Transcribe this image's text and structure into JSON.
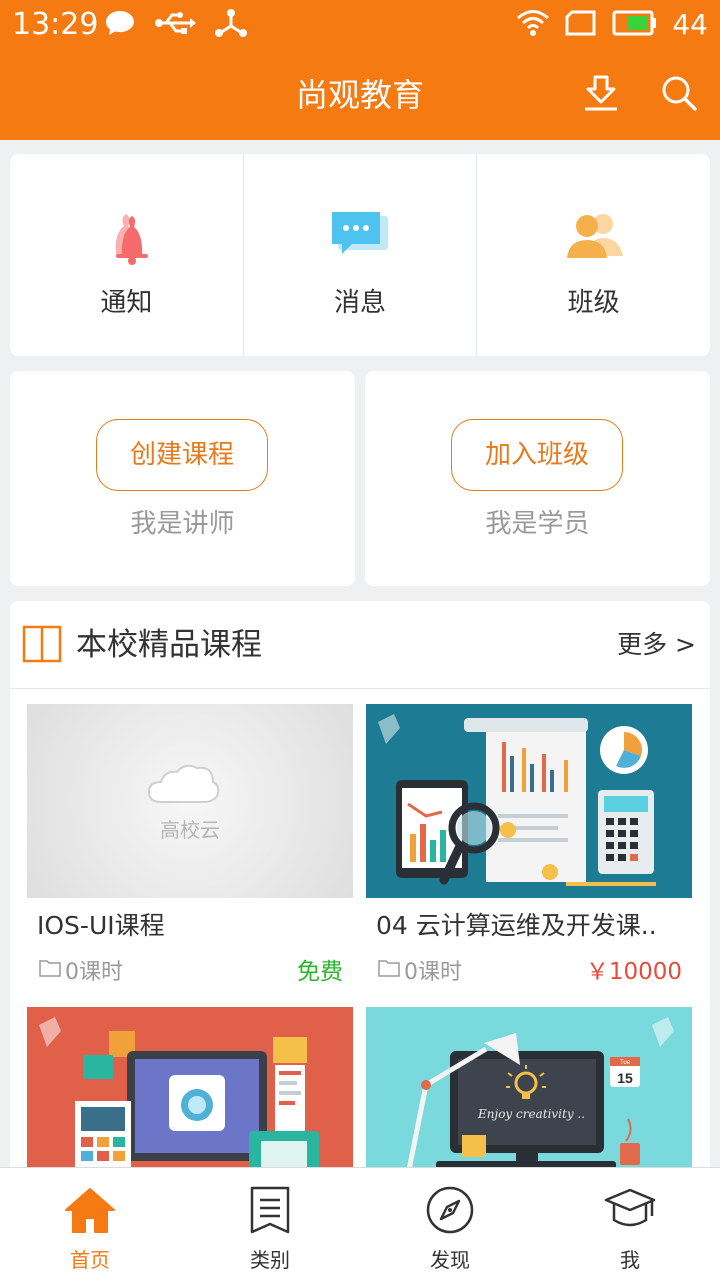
{
  "status_bar": {
    "time": "13:29",
    "battery_level": "44",
    "icons": [
      "chat-bubble-icon",
      "usb-icon",
      "share-nodes-icon",
      "wifi-icon",
      "sim-icon",
      "battery-icon"
    ]
  },
  "header": {
    "title": "尚观教育",
    "actions": [
      "download-icon",
      "search-icon"
    ]
  },
  "quick_actions": [
    {
      "label": "通知",
      "icon": "bell-icon",
      "color": "#f56a6a"
    },
    {
      "label": "消息",
      "icon": "chat-icon",
      "color": "#4fc3f0"
    },
    {
      "label": "班级",
      "icon": "users-icon",
      "color": "#f5b04b"
    }
  ],
  "roles": [
    {
      "button": "创建课程",
      "subtitle": "我是讲师"
    },
    {
      "button": "加入班级",
      "subtitle": "我是学员"
    }
  ],
  "courses_section": {
    "title": "本校精品课程",
    "more": "更多 >",
    "icon": "book-icon",
    "items": [
      {
        "title": "IOS-UI课程",
        "lessons": "0课时",
        "price": "免费",
        "thumb_text": "高校云"
      },
      {
        "title": "04 云计算运维及开发课..",
        "lessons": "0课时",
        "price": "￥10000"
      },
      {
        "title": "",
        "lessons": "",
        "price": ""
      },
      {
        "title": "",
        "lessons": "",
        "price": "",
        "thumb_text": "Enjoy creativity ..",
        "calendar_day": "15",
        "calendar_month": "Tue"
      }
    ]
  },
  "bottom_nav": [
    {
      "label": "首页",
      "icon": "home-icon",
      "active": true
    },
    {
      "label": "类别",
      "icon": "list-icon",
      "active": false
    },
    {
      "label": "发现",
      "icon": "compass-icon",
      "active": false
    },
    {
      "label": "我",
      "icon": "graduation-cap-icon",
      "active": false
    }
  ],
  "colors": {
    "brand": "#f47a11",
    "free": "#2ab52a",
    "paid": "#e84b3c",
    "role_button": "#e47b1c"
  }
}
